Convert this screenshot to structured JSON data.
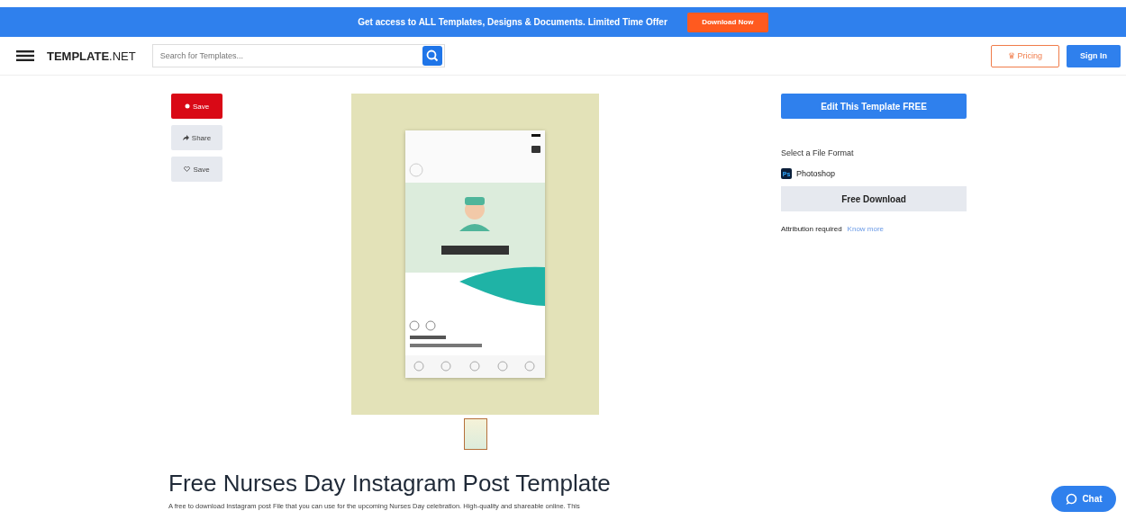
{
  "promo_banner": {
    "text": "Get access to ALL Templates, Designs & Documents. Limited Time Offer",
    "button": "Download Now"
  },
  "header": {
    "logo": {
      "bold": "TEMPLATE",
      "light": ".NET"
    },
    "search": {
      "placeholder": "Search for Templates..."
    },
    "pricing_icon": "♛",
    "pricing": "Pricing",
    "sign_in": "Sign In"
  },
  "side_actions": [
    {
      "label": "Save",
      "kind": "pin"
    },
    {
      "label": "Share",
      "kind": "share"
    },
    {
      "label": "Save",
      "kind": "heart"
    }
  ],
  "details": {
    "edit_button": "Edit This Template FREE",
    "format_label": "Select a File Format",
    "formats": [
      {
        "name": "Photoshop",
        "badge": "Ps"
      }
    ],
    "download_button": "Free Download",
    "attribution": "Attribution required",
    "know_more": "Know more"
  },
  "title": "Free Nurses Day Instagram Post Template",
  "description": "A free to download Instagram post File that you can use for the upcoming Nurses Day celebration. High-quality and shareable online. This",
  "chat": "Chat"
}
